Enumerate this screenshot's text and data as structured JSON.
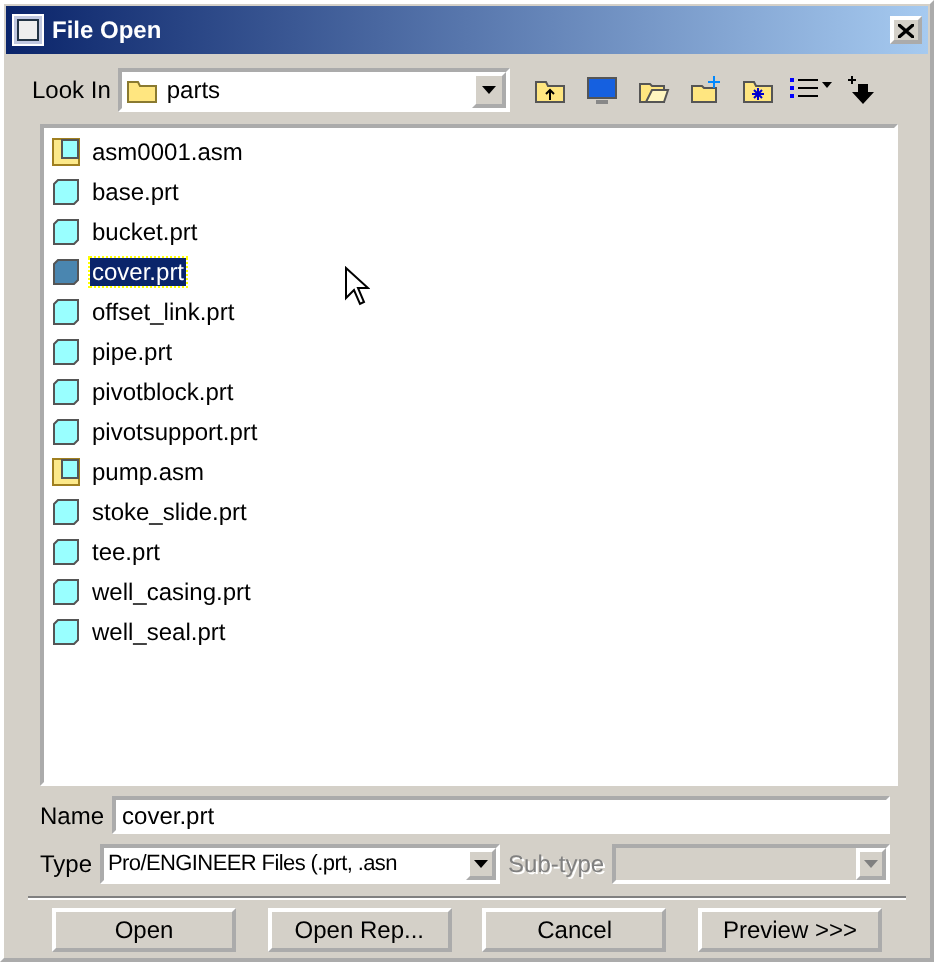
{
  "window": {
    "title": "File Open"
  },
  "look_in": {
    "label": "Look In",
    "value": "parts"
  },
  "files": [
    {
      "name": "asm0001.asm",
      "kind": "asm",
      "selected": false
    },
    {
      "name": "base.prt",
      "kind": "prt",
      "selected": false
    },
    {
      "name": "bucket.prt",
      "kind": "prt",
      "selected": false
    },
    {
      "name": "cover.prt",
      "kind": "prt",
      "selected": true
    },
    {
      "name": "offset_link.prt",
      "kind": "prt",
      "selected": false
    },
    {
      "name": "pipe.prt",
      "kind": "prt",
      "selected": false
    },
    {
      "name": "pivotblock.prt",
      "kind": "prt",
      "selected": false
    },
    {
      "name": "pivotsupport.prt",
      "kind": "prt",
      "selected": false
    },
    {
      "name": "pump.asm",
      "kind": "asm",
      "selected": false
    },
    {
      "name": "stoke_slide.prt",
      "kind": "prt",
      "selected": false
    },
    {
      "name": "tee.prt",
      "kind": "prt",
      "selected": false
    },
    {
      "name": "well_casing.prt",
      "kind": "prt",
      "selected": false
    },
    {
      "name": "well_seal.prt",
      "kind": "prt",
      "selected": false
    }
  ],
  "name_field": {
    "label": "Name",
    "value": "cover.prt"
  },
  "type_field": {
    "label": "Type",
    "value": "Pro/ENGINEER Files (.prt, .asn"
  },
  "subtype_field": {
    "label": "Sub-type",
    "disabled": true
  },
  "buttons": [
    "Open",
    "Open Rep...",
    "Cancel",
    "Preview >>>"
  ]
}
